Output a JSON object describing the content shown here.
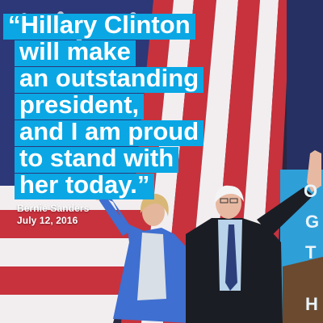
{
  "quote": {
    "lines": [
      "“Hillary Clinton",
      "will make",
      "an outstanding",
      "president,",
      "and I am proud",
      "to stand with",
      "her today.”"
    ],
    "highlight_color": "#0aa7e4"
  },
  "attribution": {
    "name": "Bernie Sanders",
    "date": "July 12, 2016"
  },
  "colors": {
    "flag_red": "#c7323d",
    "flag_white": "#f2eef0",
    "flag_blue": "#2a3a7a",
    "banner_blue": "#2f9fd8",
    "jacket_blue": "#3f6fd0",
    "suit_dark": "#1b1d24"
  },
  "banner": {
    "letters": [
      "O",
      "G",
      "T",
      "H"
    ]
  }
}
